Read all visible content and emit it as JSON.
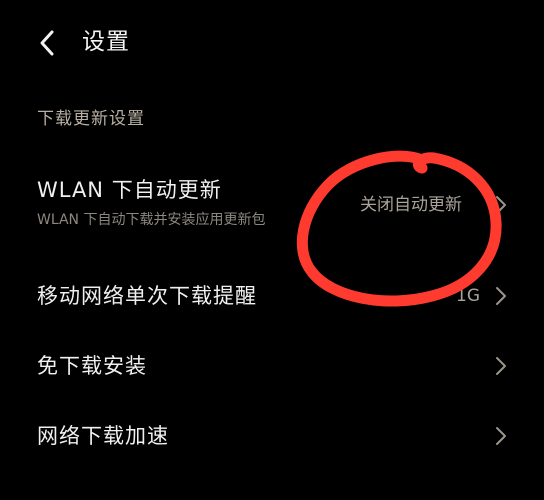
{
  "header": {
    "title": "设置",
    "back_icon": "back-arrow-icon"
  },
  "section": {
    "label": "下载更新设置"
  },
  "items": [
    {
      "title": "WLAN 下自动更新",
      "subtitle": "WLAN 下自动下载并安装应用更新包",
      "value": "关闭自动更新",
      "icon": "chevron-right-icon"
    },
    {
      "title": "移动网络单次下载提醒",
      "value": "1G",
      "icon": "chevron-right-icon"
    },
    {
      "title": "免下载安装",
      "icon": "chevron-right-icon"
    },
    {
      "title": "网络下载加速",
      "icon": "chevron-right-icon"
    }
  ],
  "colors": {
    "background": "#000000",
    "annotation": "#ff3b30"
  }
}
